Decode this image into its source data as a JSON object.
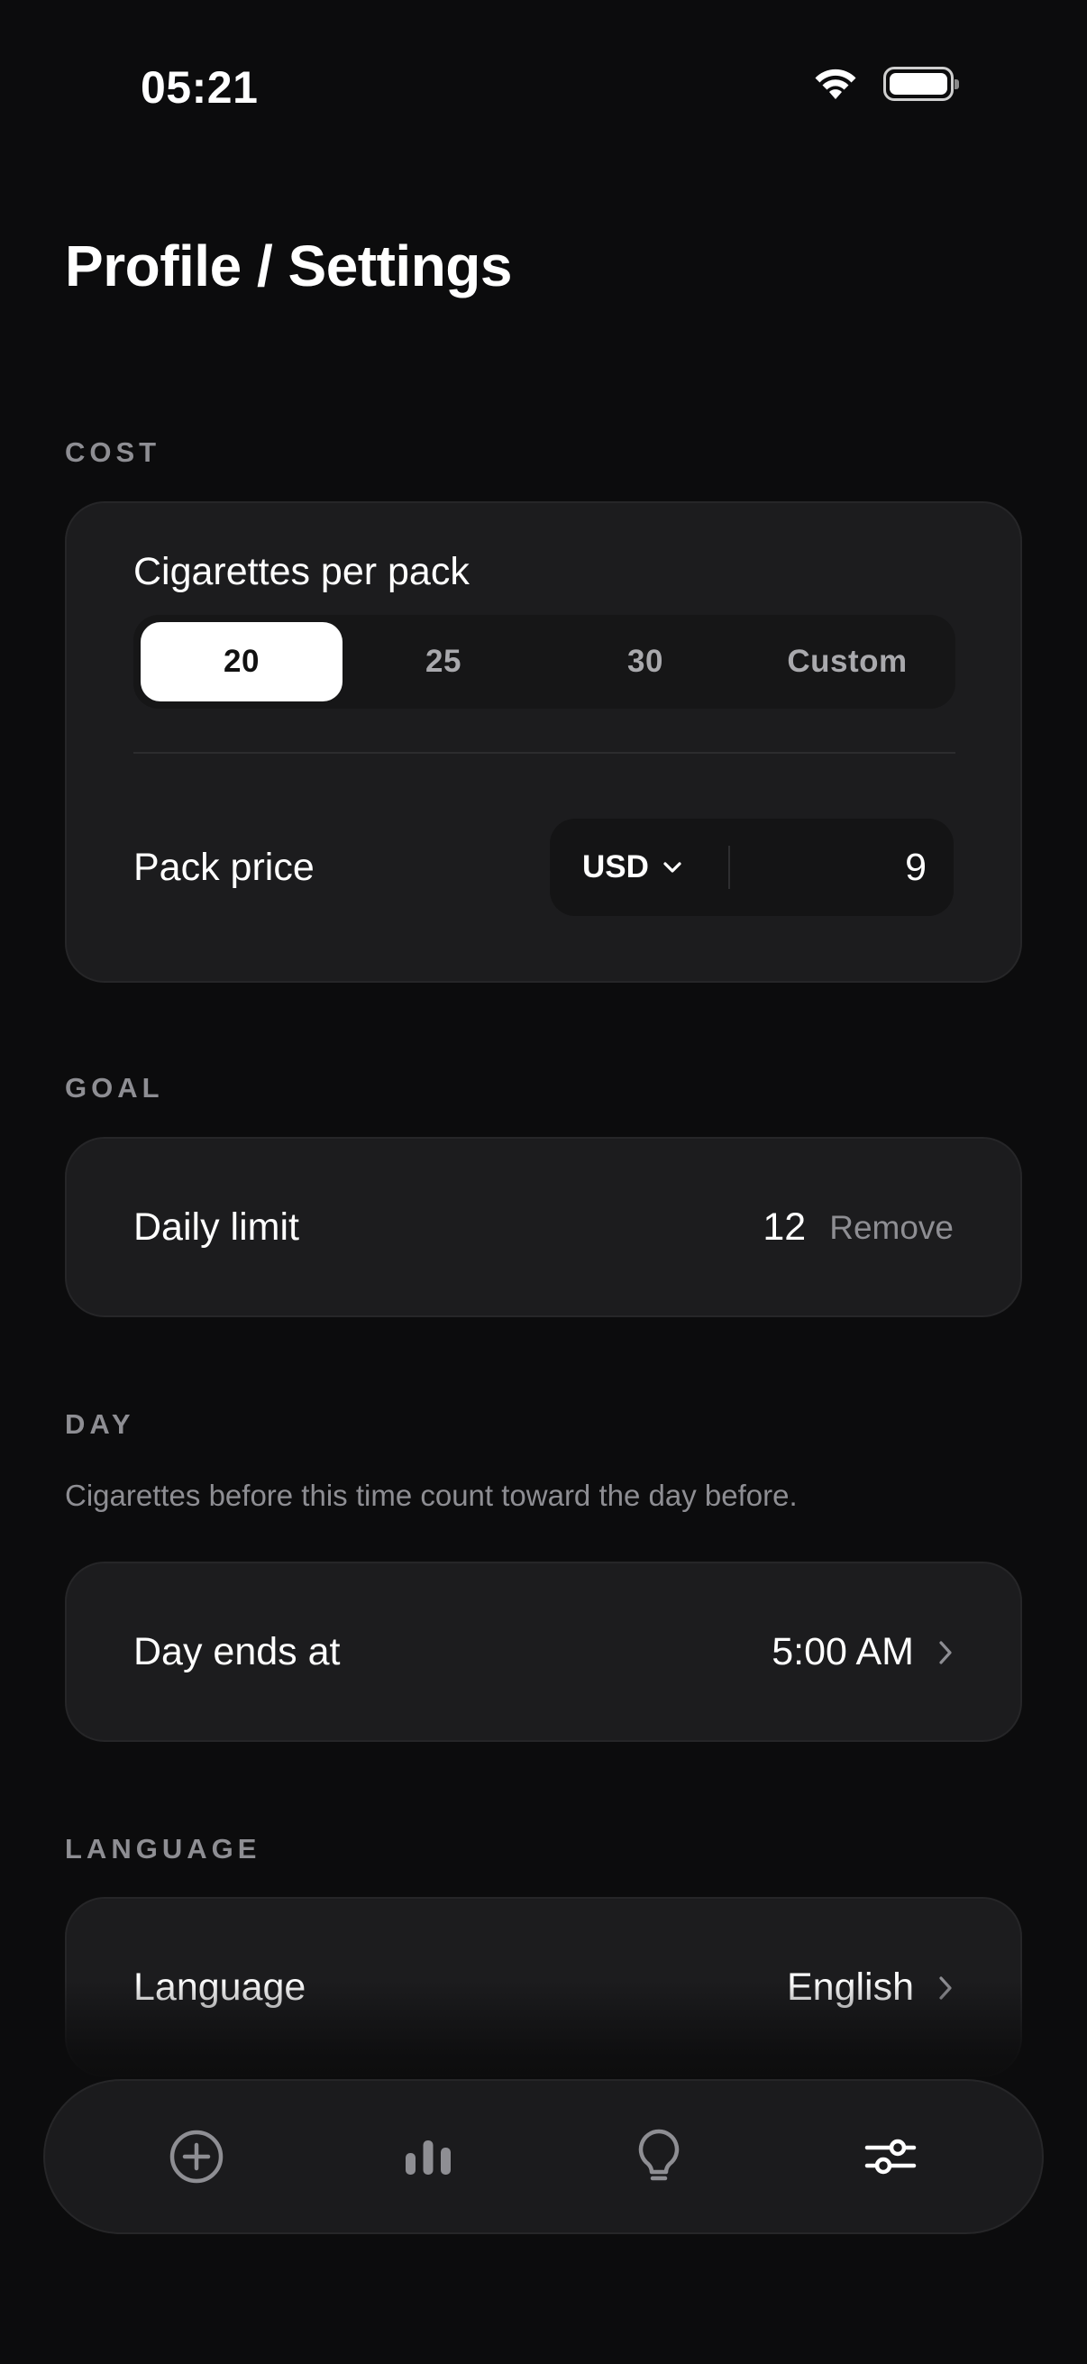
{
  "status_bar": {
    "time": "05:21"
  },
  "page": {
    "title": "Profile / Settings"
  },
  "cost": {
    "section_label": "COST",
    "cigarettes_per_pack_label": "Cigarettes per pack",
    "pack_options": [
      "20",
      "25",
      "30",
      "Custom"
    ],
    "selected_pack_option": "20",
    "pack_price_label": "Pack price",
    "currency": "USD",
    "price": "9"
  },
  "goal": {
    "section_label": "GOAL",
    "daily_limit_label": "Daily limit",
    "daily_limit_value": "12",
    "remove_label": "Remove"
  },
  "day": {
    "section_label": "DAY",
    "hint": "Cigarettes before this time count toward the day before.",
    "day_ends_label": "Day ends at",
    "day_ends_value": "5:00 AM"
  },
  "language": {
    "section_label": "LANGUAGE",
    "label": "Language",
    "value": "English"
  },
  "tabbar": {
    "tabs": [
      {
        "icon": "add-circle-icon",
        "active": false
      },
      {
        "icon": "bar-chart-icon",
        "active": false
      },
      {
        "icon": "lightbulb-icon",
        "active": false
      },
      {
        "icon": "sliders-icon",
        "active": true
      }
    ]
  },
  "colors": {
    "background": "#0c0c0d",
    "card": "#1c1c1e",
    "accent": "#ffffff",
    "muted": "#8e8e93"
  }
}
